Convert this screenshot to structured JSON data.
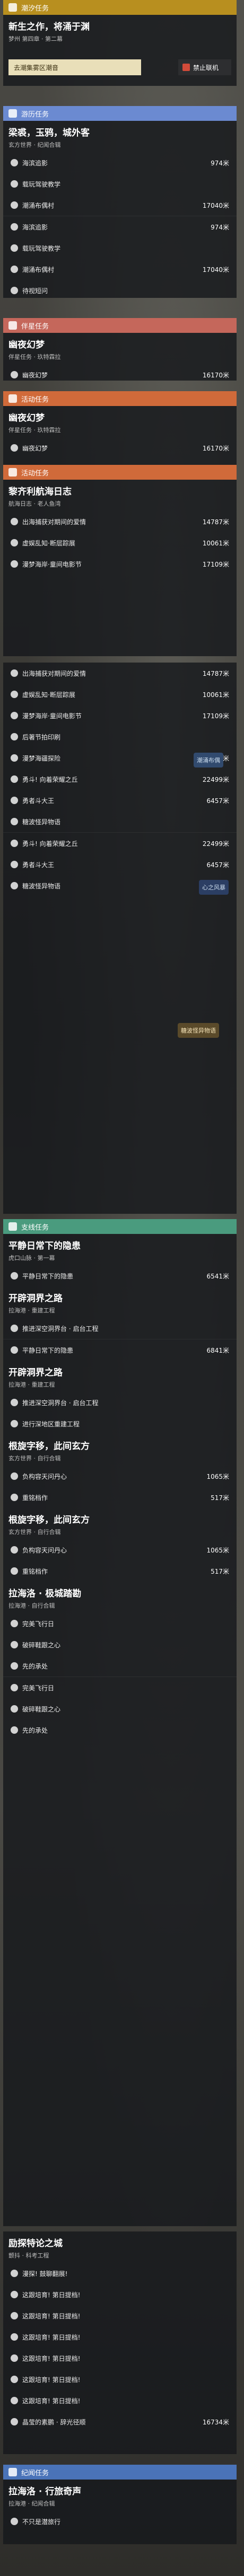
{
  "main": {
    "section": "潮汐任务",
    "title": "新生之作，将涌于渊",
    "subtitle": "梦州 第四章 · 第二幕",
    "track_button": "去潮集雾区潮音",
    "follow_label": "禁止联机"
  },
  "world": {
    "section": "游历任务",
    "title": "梁裘，玉鸦，城外客",
    "subtitle": "玄方世界 · 纪闻合辑",
    "rows": [
      {
        "label": "海滨追影",
        "dist": "974米"
      },
      {
        "label": "载玩驾驶教学",
        "dist": ""
      },
      {
        "label": "潮涌布偶村",
        "dist": "17040米"
      }
    ],
    "rows2": [
      {
        "label": "海滨追影",
        "dist": "974米"
      },
      {
        "label": "载玩驾驶教学",
        "dist": ""
      },
      {
        "label": "潮涌布偶村",
        "dist": "17040米"
      },
      {
        "label": "待视短问",
        "dist": ""
      }
    ]
  },
  "side": {
    "section": "伴星任务",
    "title": "幽夜幻梦",
    "subtitle": "伴星任务 · 玖特霖拉",
    "rows": [
      {
        "label": "幽夜幻梦",
        "dist": "16170米"
      }
    ]
  },
  "event": {
    "section": "活动任务",
    "title": "幽夜幻梦",
    "subtitle": "伴星任务 · 玖特霖拉",
    "rows": [
      {
        "label": "幽夜幻梦",
        "dist": "16170米"
      }
    ],
    "section2": "活动任务",
    "title2": "黎齐利航海日志",
    "subtitle2": "航海日志 · 老人鱼湾",
    "rows2": [
      {
        "label": "出海捕获对期间的爱情",
        "dist": "14787米"
      },
      {
        "label": "虚娱乱知·断层踪展",
        "dist": "10061米"
      },
      {
        "label": "漫梦海岸·童间电影节",
        "dist": "17109米"
      },
      {
        "label": "出海捕获对期间的爱情",
        "dist": "14787米"
      },
      {
        "label": "虚娱乱知·断层踪展",
        "dist": "10061米"
      },
      {
        "label": "漫梦海岸·童间电影节",
        "dist": "17109米"
      },
      {
        "label": "后著节拍印刷",
        "dist": ""
      },
      {
        "label": "漫梦海疆探险",
        "dist": "17725米"
      },
      {
        "label": "勇斗! 向着荣耀之丘",
        "dist": "22499米"
      },
      {
        "label": "勇者斗大王",
        "dist": "6457米"
      },
      {
        "label": "糖波怪异物语",
        "dist": ""
      }
    ],
    "rows3": [
      {
        "label": "勇斗! 向着荣耀之丘",
        "dist": "22499米"
      },
      {
        "label": "勇者斗大王",
        "dist": "6457米"
      },
      {
        "label": "糖波怪异物语",
        "dist": ""
      }
    ]
  },
  "badges": {
    "b1": "潮涌布偶",
    "b2": "心之风暴",
    "b3": "糖波怪异物语"
  },
  "sub": {
    "section": "支线任务",
    "q1_title": "平静日常下的隐患",
    "q1_sub": "虎口山脉 · 第一幕",
    "q1_rows": [
      {
        "label": "平静日常下的隐患",
        "dist": "6541米"
      }
    ],
    "q2_title": "开辟洞界之路",
    "q2_sub": "拉海港 · 重建工程",
    "q2_rows": [
      {
        "label": "推进深空洞界台 · 启台工程",
        "dist": ""
      }
    ],
    "q3_rows": [
      {
        "label": "平静日常下的隐患",
        "dist": "6841米"
      }
    ],
    "q4_title": "开辟洞界之路",
    "q4_sub": "拉海港 · 重建工程",
    "q4_rows": [
      {
        "label": "推进深空洞界台 · 启台工程",
        "dist": ""
      },
      {
        "label": "进行深地区重建工程",
        "dist": ""
      }
    ],
    "q5_title": "根旋字移，此间玄方",
    "q5_sub": "玄方世界 · 自行合辑",
    "q5_rows": [
      {
        "label": "负构容天问丹心",
        "dist": "1065米"
      },
      {
        "label": "重铭档作",
        "dist": "517米"
      }
    ],
    "q6_title": "根旋字移，此间玄方",
    "q6_sub": "玄方世界 · 自行合辑",
    "q6_rows": [
      {
        "label": "负构容天问丹心",
        "dist": "1065米"
      },
      {
        "label": "重铭档作",
        "dist": "517米"
      }
    ],
    "q7_title": "拉海洛 · 极城踏勘",
    "q7_sub": "拉海港 · 自行合辑",
    "q7_rows": [
      {
        "label": "完美飞行日",
        "dist": ""
      },
      {
        "label": "破碎鞋跟之心",
        "dist": ""
      },
      {
        "label": "先的承处",
        "dist": ""
      }
    ],
    "q8_rows": [
      {
        "label": "完美飞行日",
        "dist": ""
      },
      {
        "label": "破碎鞋跟之心",
        "dist": ""
      },
      {
        "label": "先的承处",
        "dist": ""
      }
    ],
    "q9_title": "励探特论之城",
    "q9_sub": "颤抖 · 科考工程",
    "q9_rows": [
      {
        "label": "漫探! 鼓聊翻展!",
        "dist": ""
      },
      {
        "label": "这跟培育! 第日提档!",
        "dist": ""
      },
      {
        "label": "这跟培育! 第日提档!",
        "dist": ""
      },
      {
        "label": "这跟培育! 第日提档!",
        "dist": ""
      },
      {
        "label": "这跟培育! 第日提档!",
        "dist": ""
      },
      {
        "label": "这跟培育! 第日提档!",
        "dist": ""
      },
      {
        "label": "这跟培育! 第日提档!",
        "dist": ""
      },
      {
        "label": "晶莹的素鹏 · 辞光径顺",
        "dist": "16734米"
      }
    ]
  },
  "daily": {
    "section": "纪闻任务",
    "title": "拉海洛 · 行旅奇声",
    "subtitle": "拉海港 · 纪闻合辑",
    "rows": [
      {
        "label": "不只是潜旅行",
        "dist": ""
      }
    ]
  }
}
